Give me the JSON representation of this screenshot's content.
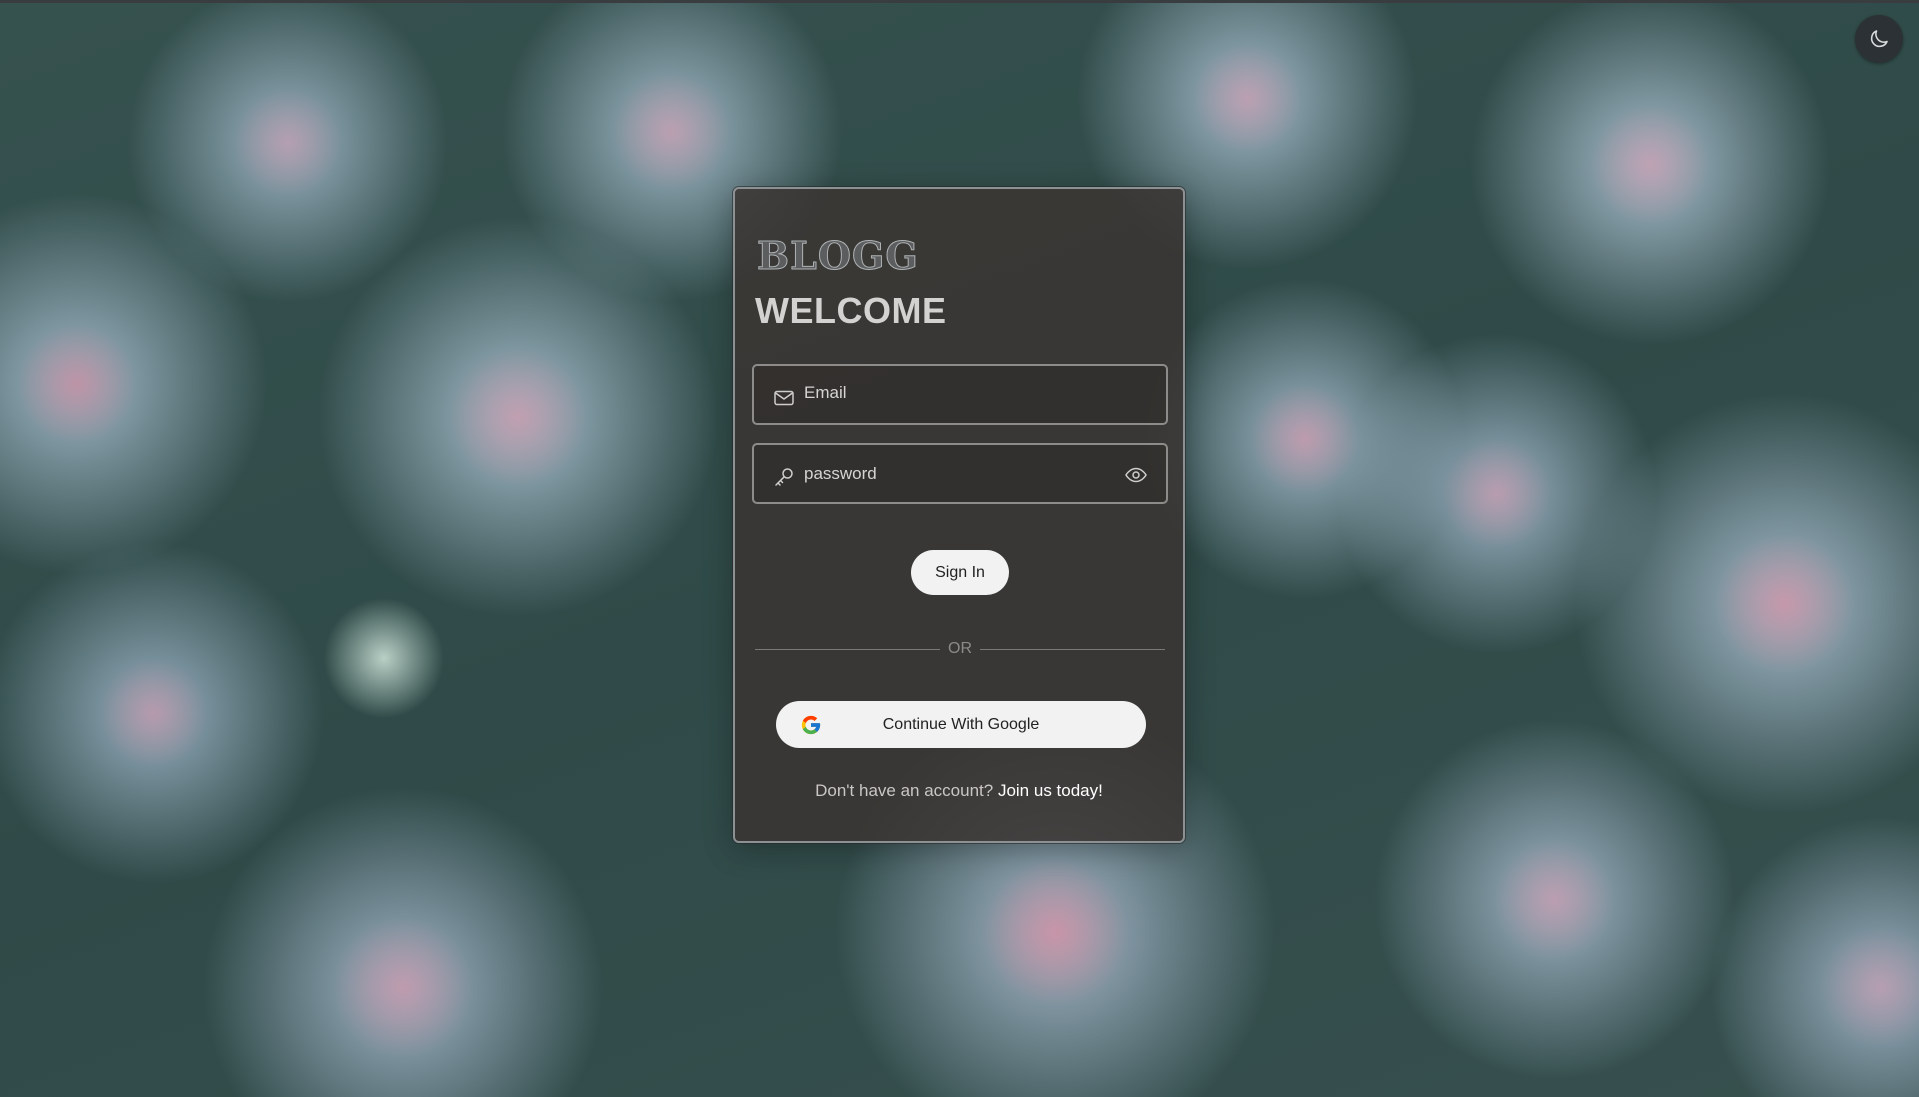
{
  "brand": {
    "logo_text": "BLOGG"
  },
  "login": {
    "title": "WELCOME",
    "email_placeholder": "Email",
    "password_placeholder": "password",
    "sign_in_label": "Sign In",
    "divider_text": "OR",
    "google_label": "Continue With Google",
    "signup_prompt": "Don't have an account?",
    "signup_link": "Join us today!"
  },
  "icons": {
    "theme_toggle": "moon-icon",
    "email": "envelope-icon",
    "password": "key-icon",
    "show_password": "eye-icon",
    "google": "google-icon"
  },
  "colors": {
    "card_bg": "#3a3432",
    "button_bg": "#f2f2f2",
    "text_light": "#d4d2d0"
  }
}
